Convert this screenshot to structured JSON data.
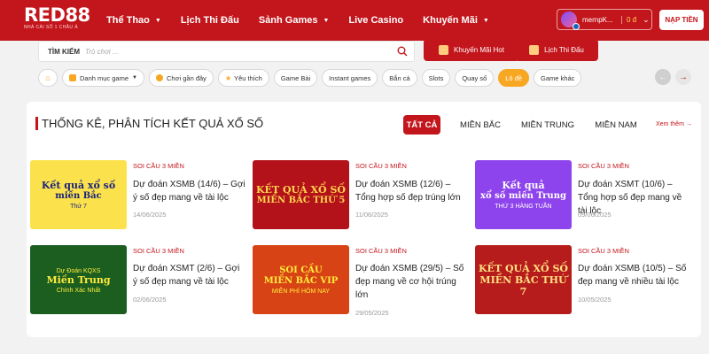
{
  "header": {
    "logo_main": "RED88",
    "logo_sub": "NHÀ CÁI SỐ 1 CHÂU Á",
    "nav": [
      {
        "label": "Thể Thao",
        "has_dropdown": true
      },
      {
        "label": "Lịch Thi Đấu",
        "has_dropdown": false
      },
      {
        "label": "Sảnh Games",
        "has_dropdown": true
      },
      {
        "label": "Live Casino",
        "has_dropdown": false
      },
      {
        "label": "Khuyến Mãi",
        "has_dropdown": true
      }
    ],
    "username": "mernpK...",
    "balance": "0 đ",
    "deposit_label": "NẠP TIỀN"
  },
  "search": {
    "label": "TÌM KIẾM",
    "placeholder": "Trò chơi ..."
  },
  "quick_buttons": {
    "promo": "Khuyến Mãi Hot",
    "schedule": "Lịch Thi Đấu"
  },
  "categories": [
    {
      "label": "Danh mục game",
      "icon": "grid-icon"
    },
    {
      "label": "Chơi gần đây",
      "icon": "clock-icon"
    },
    {
      "label": "Yêu thích",
      "icon": "star-icon"
    },
    {
      "label": "Game Bài"
    },
    {
      "label": "Instant games"
    },
    {
      "label": "Bắn cá"
    },
    {
      "label": "Slots"
    },
    {
      "label": "Quay số"
    },
    {
      "label": "Lô đề",
      "active": true
    },
    {
      "label": "Game khác"
    }
  ],
  "section": {
    "title": "THỐNG KÊ, PHÂN TÍCH KẾT QUẢ XỔ SỐ",
    "tabs": [
      "TẤT CẢ",
      "MIỀN BẮC",
      "MIỀN TRUNG",
      "MIỀN NAM"
    ],
    "active_tab": "TẤT CẢ",
    "see_more": "Xem thêm"
  },
  "articles": [
    {
      "category": "SOI CẦU 3 MIỀN",
      "title": "Dự đoán XSMB (14/6) – Gợi ý số đẹp mang về tài lộc",
      "date": "14/06/2025",
      "thumb": {
        "line1": "Kết quả xổ số",
        "line2": "miền Bắc",
        "line3": "Thứ 7",
        "bg": "#fbe24c",
        "fg": "#1a237e"
      }
    },
    {
      "category": "SOI CẦU 3 MIỀN",
      "title": "Dự đoán XSMB (12/6) – Tổng hợp số đẹp trúng lớn",
      "date": "11/06/2025",
      "thumb": {
        "line1": "KẾT QUẢ XỔ SỐ",
        "line2": "MIỀN BẮC THỨ 5",
        "line3": "",
        "bg": "#b3121a",
        "fg": "#ffd54f"
      }
    },
    {
      "category": "SOI CẦU 3 MIỀN",
      "title": "Dự đoán XSMT (10/6) – Tổng hợp số đẹp mang về tài lộc",
      "date": "09/06/2025",
      "thumb": {
        "line1": "Kết quả",
        "line2": "xổ số miền Trung",
        "line3": "THỨ 3 HÀNG TUẦN",
        "bg": "#8e44ec",
        "fg": "#ffffff"
      }
    },
    {
      "category": "SOI CẦU 3 MIỀN",
      "title": "Dự đoán XSMT (2/6) – Gợi ý số đẹp mang về tài lộc",
      "date": "02/06/2025",
      "thumb": {
        "line1": "Dự Đoán KQXS",
        "line2": "Miền Trung",
        "line3": "Chính Xác Nhất",
        "bg": "#1b5e20",
        "fg": "#ffeb3b"
      }
    },
    {
      "category": "SOI CẦU 3 MIỀN",
      "title": "Dự đoán XSMB (29/5) – Số đẹp mang về cơ hội trúng lớn",
      "date": "29/05/2025",
      "thumb": {
        "line1": "SOI CẦU",
        "line2": "MIỀN BẮC VIP",
        "line3": "MIỄN PHÍ HÔM NAY",
        "bg": "#d84315",
        "fg": "#ffeb3b"
      }
    },
    {
      "category": "SOI CẦU 3 MIỀN",
      "title": "Dự đoán XSMB (10/5) – Số đẹp mang về nhiều tài lộc",
      "date": "10/05/2025",
      "thumb": {
        "line1": "KẾT QUẢ XỔ SỐ",
        "line2": "MIỀN BẮC THỨ 7",
        "line3": "",
        "bg": "#b71c1c",
        "fg": "#ffe082"
      }
    }
  ]
}
